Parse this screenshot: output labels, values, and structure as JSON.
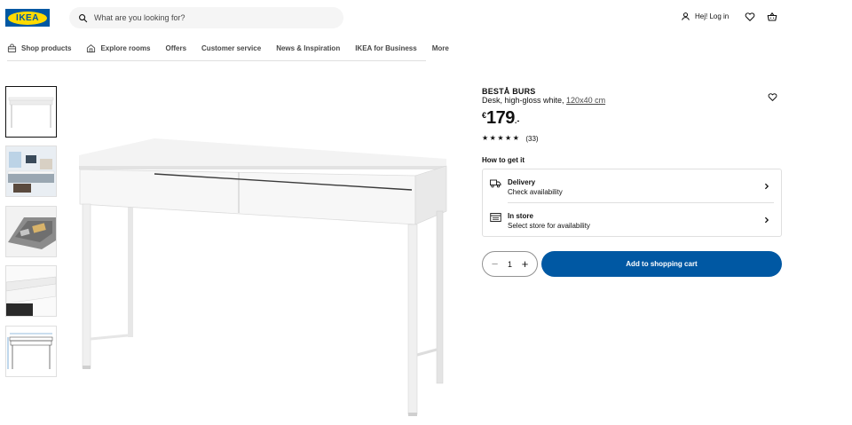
{
  "brand": {
    "logo_text": "IKEA",
    "blue": "#0058a3",
    "yellow": "#ffdb00"
  },
  "header": {
    "search_placeholder": "What are you looking for?",
    "login_label": "Hej! Log in",
    "icons": [
      "search-icon",
      "user-icon",
      "heart-icon",
      "cart-icon"
    ]
  },
  "nav": {
    "items": [
      {
        "label": "Shop products",
        "icon": "bag-icon"
      },
      {
        "label": "Explore rooms",
        "icon": "house-icon"
      },
      {
        "label": "Offers"
      },
      {
        "label": "Customer service"
      },
      {
        "label": "News & Inspiration"
      },
      {
        "label": "IKEA for Business"
      },
      {
        "label": "More"
      }
    ]
  },
  "gallery": {
    "thumbnails": [
      "desk-front-white",
      "desk-in-room",
      "drawer-open-detail",
      "desk-corner-detail",
      "desk-dimensions-drawing"
    ],
    "selected_index": 0
  },
  "product": {
    "name": "BESTÅ BURS",
    "description": "Desk, high-gloss white, ",
    "size_link": "120x40 cm",
    "currency": "€",
    "price": "179",
    "price_suffix": ".-",
    "rating": 5,
    "review_count": "(33)"
  },
  "fulfilment": {
    "heading": "How to get it",
    "delivery_title": "Delivery",
    "delivery_sub": "Check availability",
    "store_title": "In store",
    "store_sub": "Select store for availability"
  },
  "cart": {
    "quantity": "1",
    "add_label": "Add to shopping cart"
  }
}
